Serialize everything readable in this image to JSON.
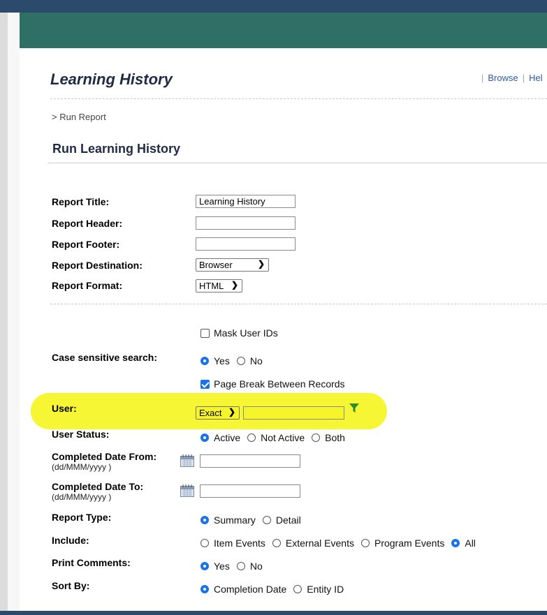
{
  "app": {
    "title": "Learning History"
  },
  "header_links": {
    "browse": "Browse",
    "help": "Hel",
    "sep1": "|",
    "sep2": "|"
  },
  "breadcrumb": "> Run Report",
  "page_title": "Run Learning History",
  "form": {
    "report_title": {
      "label": "Report Title:",
      "value": "Learning History"
    },
    "report_header": {
      "label": "Report Header:",
      "value": ""
    },
    "report_footer": {
      "label": "Report Footer:",
      "value": ""
    },
    "report_destination": {
      "label": "Report Destination:",
      "selected": "Browser"
    },
    "report_format": {
      "label": "Report Format:",
      "selected": "HTML"
    },
    "mask_user_ids": {
      "label": "Mask User IDs",
      "checked": false
    },
    "case_sensitive": {
      "label": "Case sensitive search:",
      "yes": "Yes",
      "no": "No",
      "selected": "Yes"
    },
    "page_break": {
      "label": "Page Break Between Records",
      "checked": true
    },
    "user": {
      "label": "User:",
      "match": "Exact",
      "value": ""
    },
    "user_status": {
      "label": "User Status:",
      "active": "Active",
      "not_active": "Not Active",
      "both": "Both",
      "selected": "Active"
    },
    "completed_from": {
      "label": "Completed Date From:",
      "hint": "(dd/MMM/yyyy )",
      "value": ""
    },
    "completed_to": {
      "label": "Completed Date To:",
      "hint": "(dd/MMM/yyyy )",
      "value": ""
    },
    "report_type": {
      "label": "Report Type:",
      "summary": "Summary",
      "detail": "Detail",
      "selected": "Summary"
    },
    "include": {
      "label": "Include:",
      "item": "Item Events",
      "external": "External Events",
      "program": "Program Events",
      "all": "All",
      "selected": "All"
    },
    "print_comments": {
      "label": "Print Comments:",
      "yes": "Yes",
      "no": "No",
      "selected": "Yes"
    },
    "sort_by": {
      "label": "Sort By:",
      "completion": "Completion Date",
      "entity": "Entity ID",
      "selected": "Completion Date"
    }
  },
  "colors": {
    "banner": "#2e7066",
    "topbar": "#2c4a6b",
    "highlight": "#f5f52a",
    "radio_selected": "#1a73e8",
    "filter_icon": "#2e8b2e"
  }
}
